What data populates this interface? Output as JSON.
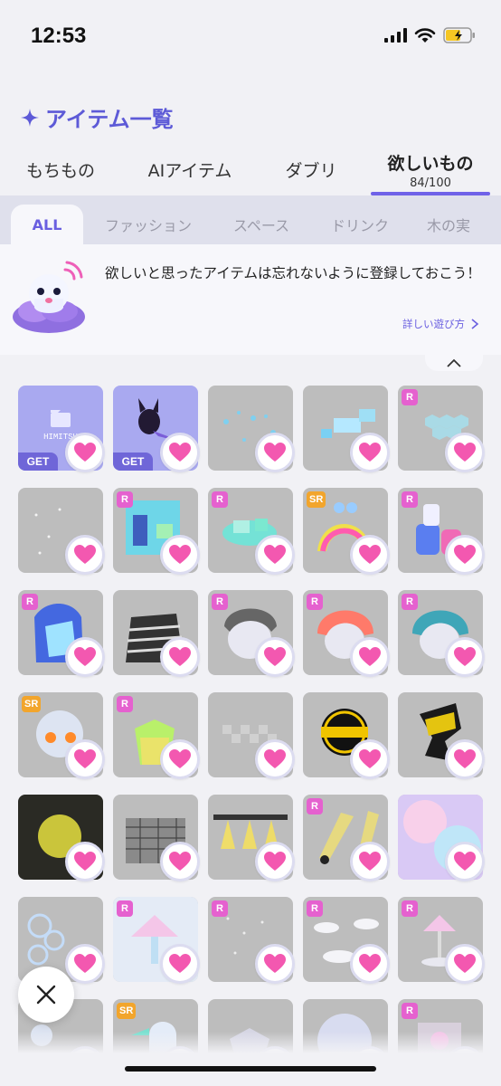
{
  "status_bar": {
    "time": "12:53"
  },
  "header": {
    "title": "アイテム一覧"
  },
  "main_tabs": [
    {
      "label": "もちもの"
    },
    {
      "label": "AIアイテム"
    },
    {
      "label": "ダブリ"
    },
    {
      "label": "欲しいもの",
      "count": "84/100",
      "active": true
    }
  ],
  "sub_tabs": [
    {
      "label": "ALL",
      "active": true
    },
    {
      "label": "ファッション"
    },
    {
      "label": "スペース"
    },
    {
      "label": "ドリンク"
    },
    {
      "label": "木の実"
    }
  ],
  "banner": {
    "message": "欲しいと思ったアイテムは忘れないように登録しておこう！",
    "link": "詳しい遊び方"
  },
  "items_visible": [
    {
      "rarity": "",
      "get": true,
      "label": "HIMITSU",
      "bg": "purple"
    },
    {
      "rarity": "",
      "get": true,
      "bg": "purple"
    },
    {
      "rarity": ""
    },
    {
      "rarity": ""
    },
    {
      "rarity": "R"
    },
    {
      "rarity": ""
    },
    {
      "rarity": "R"
    },
    {
      "rarity": "R"
    },
    {
      "rarity": "SR"
    },
    {
      "rarity": "R"
    },
    {
      "rarity": "R"
    },
    {
      "rarity": ""
    },
    {
      "rarity": "R"
    },
    {
      "rarity": "R"
    },
    {
      "rarity": "R"
    },
    {
      "rarity": "SR"
    },
    {
      "rarity": "R"
    },
    {
      "rarity": ""
    },
    {
      "rarity": ""
    },
    {
      "rarity": ""
    },
    {
      "rarity": ""
    },
    {
      "rarity": ""
    },
    {
      "rarity": ""
    },
    {
      "rarity": "R"
    },
    {
      "rarity": ""
    },
    {
      "rarity": ""
    },
    {
      "rarity": "R"
    },
    {
      "rarity": "R"
    },
    {
      "rarity": "R"
    },
    {
      "rarity": "R"
    },
    {
      "rarity": ""
    },
    {
      "rarity": "SR"
    },
    {
      "rarity": ""
    },
    {
      "rarity": ""
    },
    {
      "rarity": "R"
    }
  ],
  "get_label": "GET",
  "colors": {
    "accent": "#6a5fe0",
    "heart": "#f358b0",
    "rarity_r": "#e561cf",
    "rarity_sr": "#f2a52c",
    "card_bg": "#bdbdbd",
    "card_purple": "#a9a9f0"
  }
}
